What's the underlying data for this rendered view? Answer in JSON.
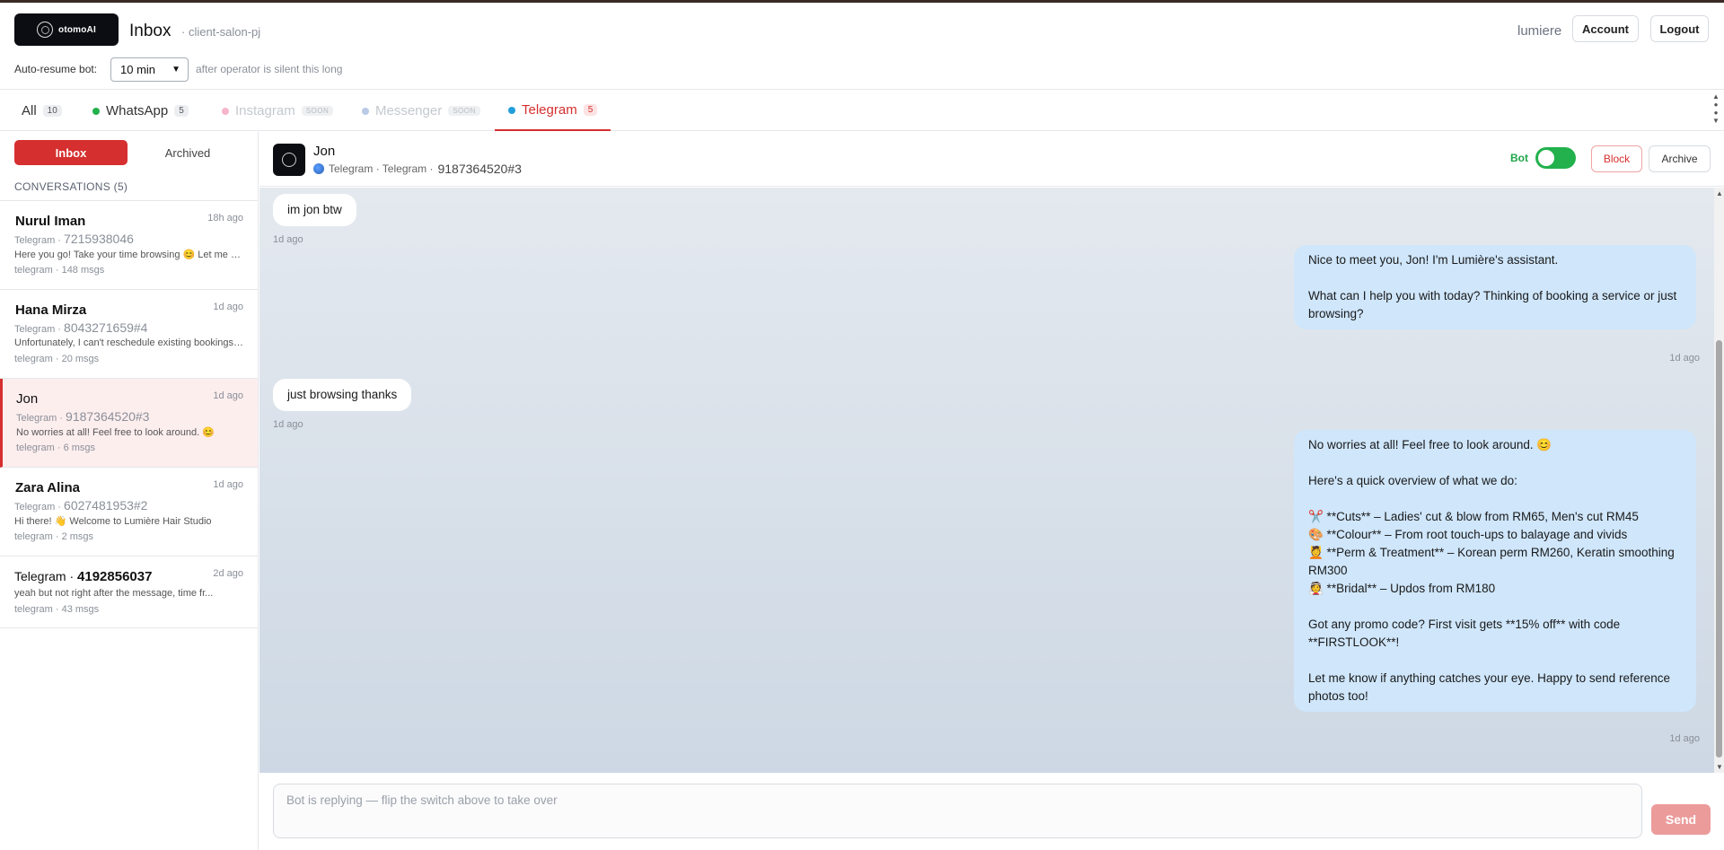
{
  "header": {
    "logo_text": "otomoAI",
    "title": "Inbox",
    "subtitle": "· client-salon-pj",
    "user": "lumiere",
    "account_label": "Account",
    "logout_label": "Logout",
    "resume_label": "Auto-resume bot:",
    "resume_value": "10 min",
    "resume_hint": "after operator is silent this long"
  },
  "tabs": [
    {
      "label": "All",
      "count": "10",
      "dot_color": null,
      "state": "normal"
    },
    {
      "label": "WhatsApp",
      "count": "5",
      "dot_color": "#22b14c",
      "state": "normal"
    },
    {
      "label": "Instagram",
      "count": "SOON",
      "dot_color": "#f5b5cc",
      "state": "disabled"
    },
    {
      "label": "Messenger",
      "count": "SOON",
      "dot_color": "#b9c9e6",
      "state": "disabled"
    },
    {
      "label": "Telegram",
      "count": "5",
      "dot_color": "#229ed9",
      "state": "active"
    }
  ],
  "sidebar": {
    "inbox_label": "Inbox",
    "archived_label": "Archived",
    "conversations_header": "CONVERSATIONS (5)",
    "conversations": [
      {
        "name": "Nurul Iman",
        "time": "18h ago",
        "channel": "Telegram ·",
        "number": "7215938046",
        "preview": "Here you go! Take your time browsing 😊 Let me know if anything catches your eye",
        "meta": "telegram · 148 msgs"
      },
      {
        "name": "Hana Mirza",
        "time": "1d ago",
        "channel": "Telegram ·",
        "number": "8043271659#4",
        "preview": "Unfortunately, I can't reschedule existing bookings directly",
        "meta": "telegram · 20 msgs"
      },
      {
        "name": "Jon",
        "time": "1d ago",
        "channel": "Telegram ·",
        "number": "9187364520#3",
        "preview": "No worries at all! Feel free to look around. 😊",
        "meta": "telegram · 6 msgs"
      },
      {
        "name": "Zara Alina",
        "time": "1d ago",
        "channel": "Telegram ·",
        "number": "6027481953#2",
        "preview": "Hi there! 👋 Welcome to Lumière Hair Studio",
        "meta": "telegram · 2 msgs"
      },
      {
        "name_prefix": "Telegram ·",
        "name": "4192856037",
        "time": "2d ago",
        "preview": "yeah but not right after the message, time fr...",
        "meta": "telegram · 43 msgs"
      }
    ]
  },
  "chat": {
    "name": "Jon",
    "sub_channel": "Telegram · Telegram ·",
    "sub_number": "9187364520#3",
    "bot_label": "Bot",
    "bot_enabled": true,
    "block_label": "Block",
    "archive_label": "Archive",
    "messages": [
      {
        "dir": "in",
        "text": "im jon btw",
        "time": "1d ago"
      },
      {
        "dir": "out",
        "text": "Nice to meet you, Jon! I'm Lumière's assistant.\n\nWhat can I help you with today? Thinking of booking a service or just browsing?",
        "time": "1d ago"
      },
      {
        "dir": "in",
        "text": "just browsing thanks",
        "time": "1d ago"
      },
      {
        "dir": "out",
        "text": "No worries at all! Feel free to look around. 😊\n\nHere's a quick overview of what we do:\n\n✂️ **Cuts** – Ladies' cut & blow from RM65, Men's cut RM45\n🎨 **Colour** – From root touch-ups to balayage and vivids\n💆 **Perm & Treatment** – Korean perm RM260, Keratin smoothing RM300\n👰 **Bridal** – Updos from RM180\n\nGot any promo code? First visit gets **15% off** with code **FIRSTLOOK**!\n\nLet me know if anything catches your eye. Happy to send reference photos too!",
        "time": "1d ago"
      }
    ],
    "composer_placeholder": "Bot is replying — flip the switch above to take over",
    "send_label": "Send"
  }
}
